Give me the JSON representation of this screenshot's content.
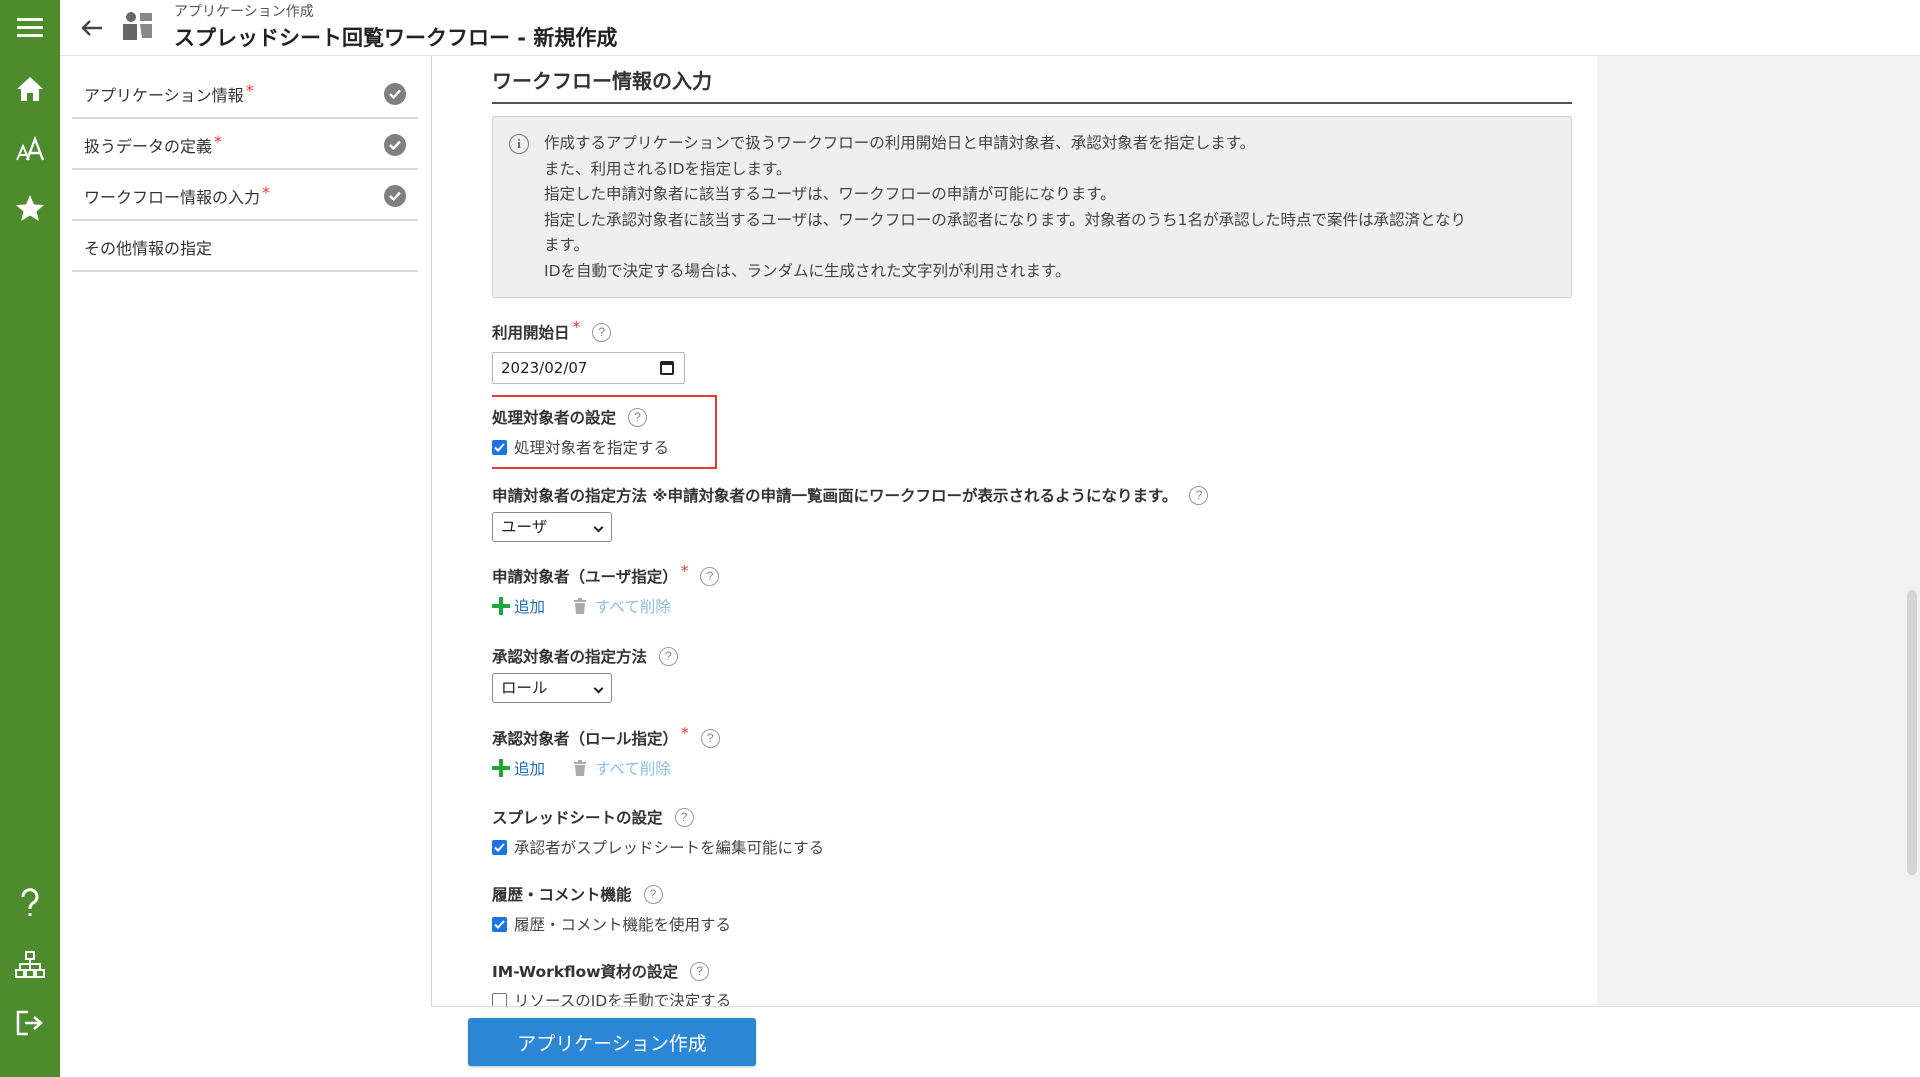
{
  "header": {
    "subtitle": "アプリケーション作成",
    "title": "スプレッドシート回覧ワークフロー - 新規作成"
  },
  "rail": {
    "icons": [
      "menu-icon",
      "home-icon",
      "font-size-icon",
      "star-icon",
      "help-icon",
      "sitemap-icon",
      "logout-icon"
    ],
    "color": "#4e8b2d"
  },
  "steps": [
    {
      "label": "アプリケーション情報",
      "required": "*",
      "completed": true
    },
    {
      "label": "扱うデータの定義",
      "required": "*",
      "completed": true
    },
    {
      "label": "ワークフロー情報の入力",
      "required": "*",
      "completed": true
    },
    {
      "label": "その他情報の指定",
      "completed": false
    }
  ],
  "section": {
    "title": "ワークフロー情報の入力"
  },
  "info": {
    "lines": [
      "作成するアプリケーションで扱うワークフローの利用開始日と申請対象者、承認対象者を指定します。",
      "また、利用されるIDを指定します。",
      "指定した申請対象者に該当するユーザは、ワークフローの申請が可能になります。",
      "指定した承認対象者に該当するユーザは、ワークフローの承認者になります。対象者のうち1名が承認した時点で案件は承認済となり",
      "ます。",
      "IDを自動で決定する場合は、ランダムに生成された文字列が利用されます。"
    ]
  },
  "fields": {
    "start_date": {
      "label": "利用開始日",
      "required": "*",
      "value": "2023/02/07"
    },
    "processor_setting": {
      "label": "処理対象者の設定",
      "checkbox_label": "処理対象者を指定する",
      "checked": true
    },
    "applicant_method": {
      "label": "申請対象者の指定方法 ※申請対象者の申請一覧画面にワークフローが表示されるようになります。",
      "value": "ユーザ"
    },
    "applicant_users": {
      "label": "申請対象者（ユーザ指定）",
      "required": "*",
      "add_label": "追加",
      "delete_all_label": "すべて削除"
    },
    "approver_method": {
      "label": "承認対象者の指定方法",
      "value": "ロール"
    },
    "approver_roles": {
      "label": "承認対象者（ロール指定）",
      "required": "*",
      "add_label": "追加",
      "delete_all_label": "すべて削除"
    },
    "spreadsheet_setting": {
      "label": "スプレッドシートの設定",
      "checkbox_label": "承認者がスプレッドシートを編集可能にする",
      "checked": true
    },
    "history_comment": {
      "label": "履歴・コメント機能",
      "checkbox_label": "履歴・コメント機能を使用する",
      "checked": true
    },
    "im_workflow": {
      "label": "IM-Workflow資材の設定",
      "checkbox_label": "リソースのIDを手動で決定する",
      "checked": false
    }
  },
  "help_glyph": "?",
  "info_glyph": "i",
  "footer": {
    "create_button": "アプリケーション作成"
  },
  "colors": {
    "accent": "#2b87d6",
    "link": "#1a6fb5",
    "required": "#e53935",
    "highlight_border": "#e53935",
    "add_icon": "#22a83a"
  }
}
